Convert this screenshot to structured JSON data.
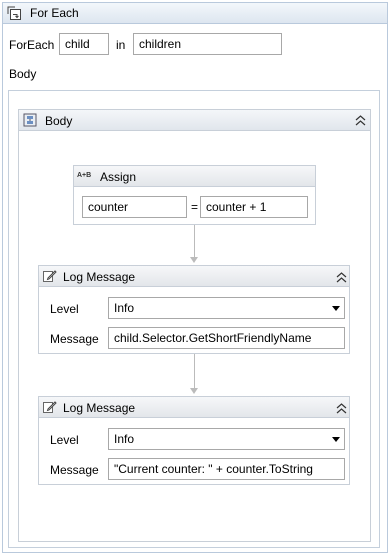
{
  "foreach": {
    "title": "For Each",
    "foreach_label": "ForEach",
    "item_var": "child",
    "in_label": "in",
    "collection": "children",
    "body_label": "Body"
  },
  "sequence": {
    "title": "Body"
  },
  "assign": {
    "title": "Assign",
    "icon_text": "A+B",
    "to": "counter",
    "equals": "=",
    "value": "counter + 1"
  },
  "log1": {
    "title": "Log Message",
    "level_label": "Level",
    "level_value": "Info",
    "message_label": "Message",
    "message_value": "child.Selector.GetShortFriendlyName"
  },
  "log2": {
    "title": "Log Message",
    "level_label": "Level",
    "level_value": "Info",
    "message_label": "Message",
    "message_value": "\"Current counter: \" + counter.ToString"
  }
}
